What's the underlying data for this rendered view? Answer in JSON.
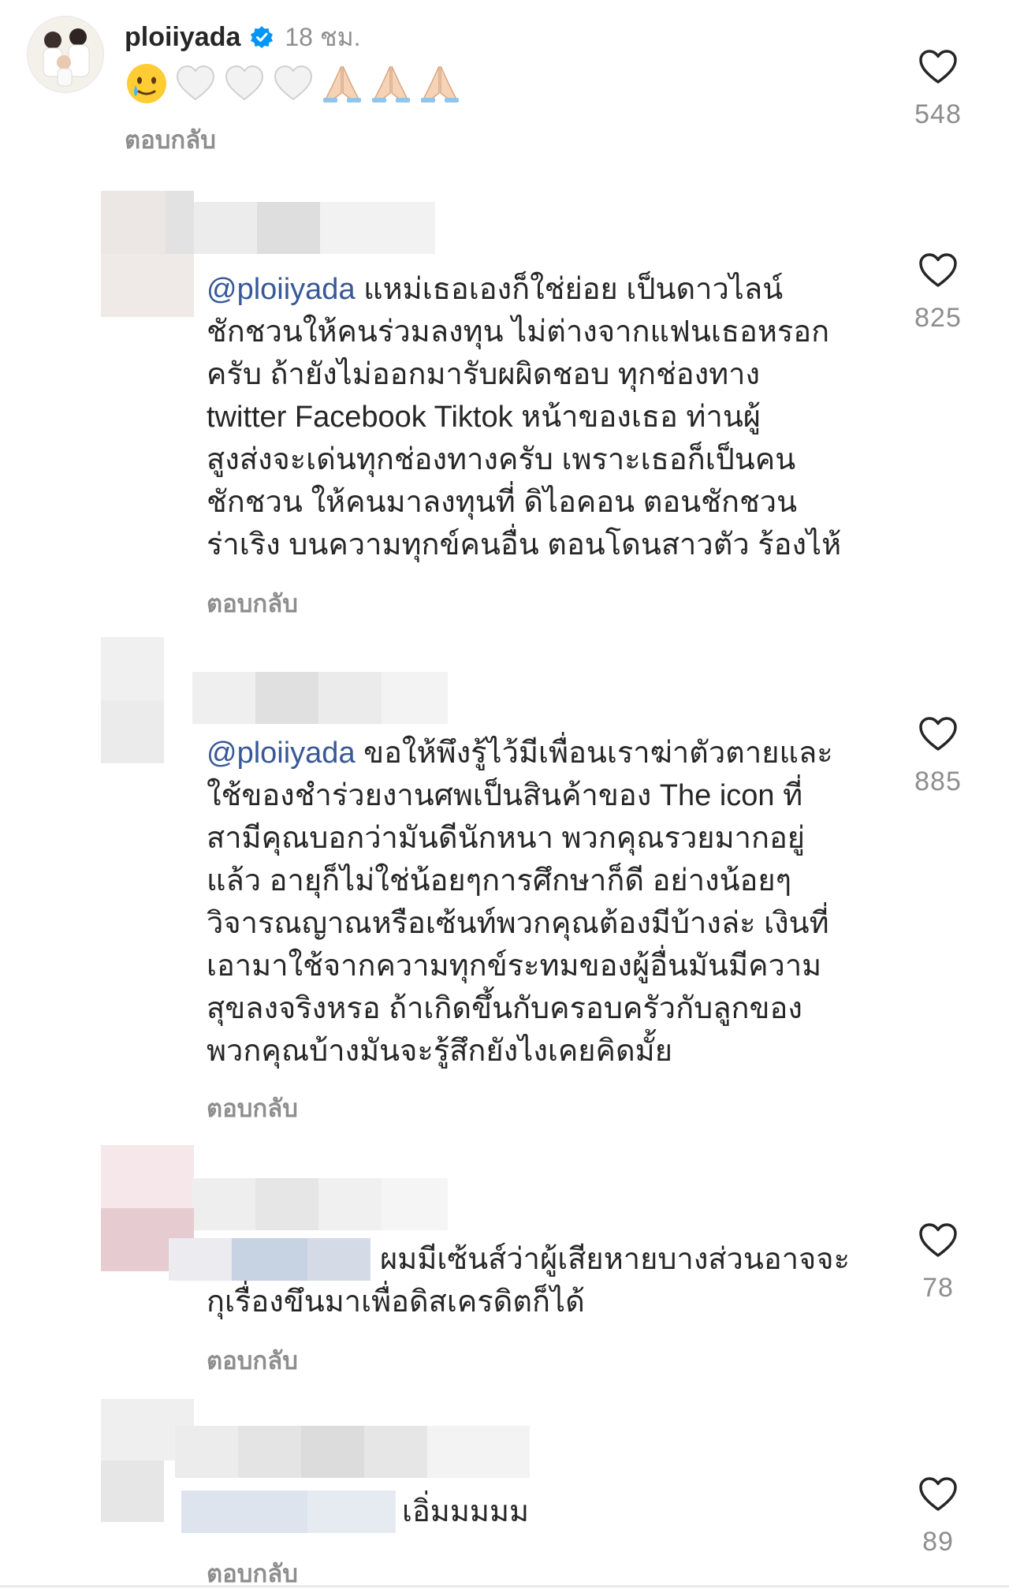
{
  "top_comment": {
    "username": "ploiiyada",
    "time": "18 ชม.",
    "emojis": [
      "tear-smile-emoji",
      "white-heart-emoji",
      "white-heart-emoji",
      "white-heart-emoji",
      "folded-hands-emoji",
      "folded-hands-emoji",
      "folded-hands-emoji"
    ],
    "reply_label": "ตอบกลับ",
    "likes": "548"
  },
  "comments": [
    {
      "mention": "@ploiiyada",
      "text": " แหม่เธอเองก็ใช่ย่อย เป็นดาวไลน์\nชักชวนให้คนร่วมลงทุน ไม่ต่างจากแฟนเธอหรอก\nครับ ถ้ายังไม่ออกมารับผผิดชอบ ทุกช่องทาง\ntwitter Facebook Tiktok หน้าของเธอ ท่านผู้\nสูงส่งจะเด่นทุกช่องทางครับ เพราะเธอก็เป็นคน\nชักชวน ให้คนมาลงทุนที่ ดิไอคอน ตอนชักชวน\nร่าเริง บนความทุกข์คนอื่น ตอนโดนสาวตัว ร้องไห้",
      "reply_label": "ตอบกลับ",
      "likes": "825"
    },
    {
      "mention": "@ploiiyada",
      "text": " ขอให้พึงรู้ไว้มีเพื่อนเราฆ่าตัวตายและ\nใช้ของชำร่วยงานศพเป็นสินค้าของ The icon ที่\nสามีคุณบอกว่ามันดีนักหนา พวกคุณรวยมากอยู่\nแล้ว อายุก็ไม่ใช่น้อยๆการศึกษาก็ดี อย่างน้อยๆ\nวิจารณญาณหรือเซ้นท์พวกคุณต้องมีบ้างล่ะ เงินที่\nเอามาใช้จากความทุกข์ระทมของผู้อื่นมันมีความ\nสุขลงจริงหรอ ถ้าเกิดขึ้นกับครอบครัวกับลูกของ\nพวกคุณบ้างมันจะรู้สึกยังไงเคยคิดมั้ย",
      "reply_label": "ตอบกลับ",
      "likes": "885"
    },
    {
      "mention": "",
      "text": "ผมมีเซ้นส์ว่าผู้เสียหายบางส่วนอาจจะ\nกุเรื่องขึนมาเพื่อดิสเครดิตก็ได้",
      "reply_label": "ตอบกลับ",
      "likes": "78"
    },
    {
      "mention": "",
      "text": "เอิ่มมมมม",
      "reply_label": "ตอบกลับ",
      "likes": "89"
    }
  ]
}
